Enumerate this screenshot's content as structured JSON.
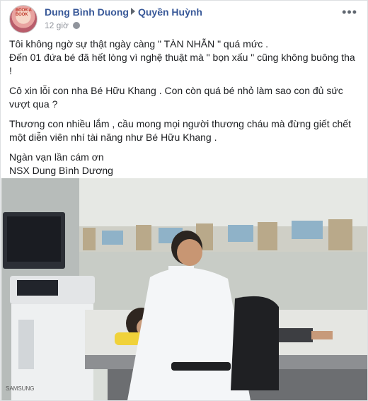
{
  "post": {
    "author": "Dung Bình Duong",
    "target": "Quyền Huỳnh",
    "timestamp": "12 giờ",
    "avatar_text": "BOOK A BOOK",
    "paragraphs": [
      "Tôi không ngờ sự thật ngày càng \" TÀN NHẪN \" quá mức .\nĐến 01 đứa bé đã hết lòng vì nghệ thuật mà \" bọn xấu \" cũng không buông tha !",
      "Cô xin lỗi con nha Bé Hữu Khang . Con còn quá bé nhỏ làm sao con đủ sức vượt qua ?",
      "Thương con nhiều lắm , cầu mong mọi người thương cháu mà đừng giết chết một diễn viên nhí tài năng như Bé Hữu Khang .",
      "Ngàn vạn lần cám ơn\nNSX Dung Bình Dương"
    ],
    "menu_icon": "more-options-icon",
    "privacy_icon": "globe-icon",
    "photo_brand": "SAMSUNG"
  }
}
